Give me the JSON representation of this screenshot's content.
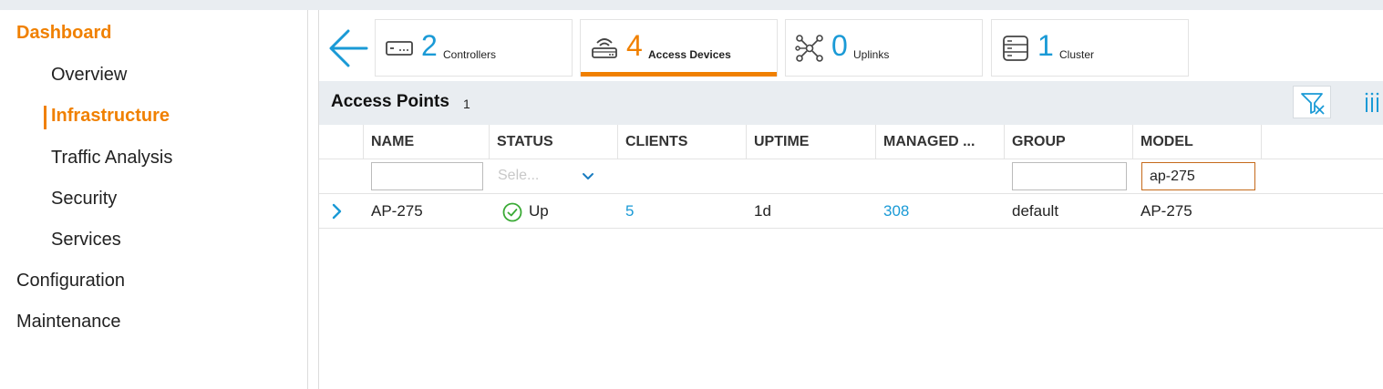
{
  "sidebar": {
    "items": [
      {
        "label": "Dashboard"
      },
      {
        "label": "Overview"
      },
      {
        "label": "Infrastructure"
      },
      {
        "label": "Traffic Analysis"
      },
      {
        "label": "Security"
      },
      {
        "label": "Services"
      },
      {
        "label": "Configuration"
      },
      {
        "label": "Maintenance"
      }
    ]
  },
  "summary_cards": [
    {
      "count": "2",
      "label": "Controllers",
      "icon": "controller-icon"
    },
    {
      "count": "4",
      "label": "Access Devices",
      "icon": "access-device-icon",
      "active": true
    },
    {
      "count": "0",
      "label": "Uplinks",
      "icon": "uplinks-icon"
    },
    {
      "count": "1",
      "label": "Cluster",
      "icon": "cluster-icon"
    }
  ],
  "panel": {
    "title": "Access Points",
    "count": "1"
  },
  "table": {
    "columns": [
      "NAME",
      "STATUS",
      "CLIENTS",
      "UPTIME",
      "MANAGED ...",
      "GROUP",
      "MODEL"
    ],
    "filters": {
      "name": "",
      "status_placeholder": "Sele...",
      "group": "",
      "model": "ap-275"
    },
    "rows": [
      {
        "name": "AP-275",
        "status": "Up",
        "clients": "5",
        "uptime": "1d",
        "managed": "308",
        "group": "default",
        "model": "AP-275"
      }
    ]
  },
  "colors": {
    "accent": "#f08000",
    "link": "#1a9ad6",
    "status_ok": "#3aaa35"
  }
}
